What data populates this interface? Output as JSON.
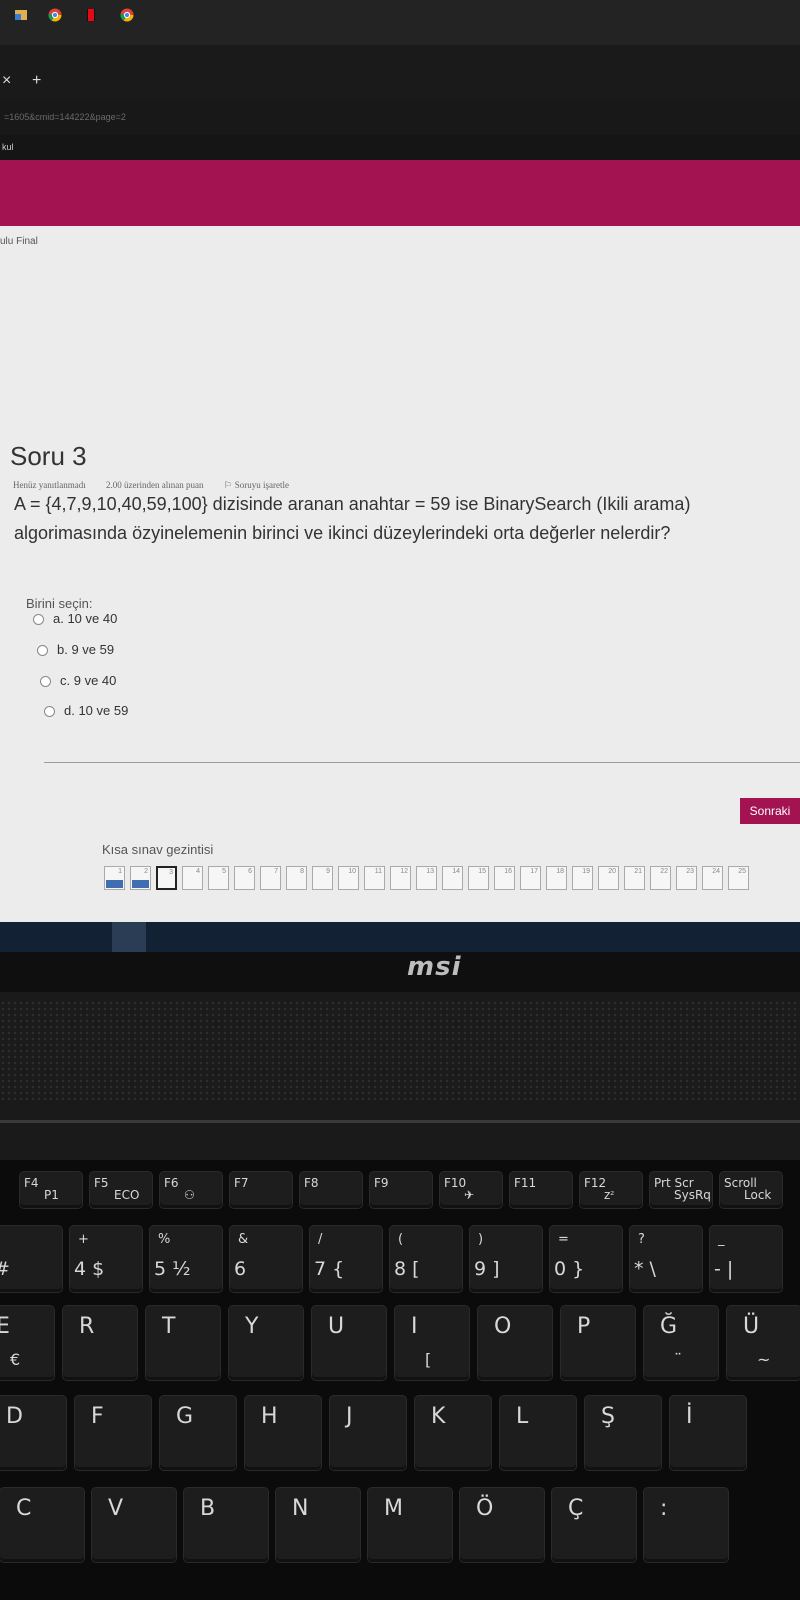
{
  "browser": {
    "tab_close": "×",
    "tab_new": "+",
    "url": "=1605&cmid=144222&page=2",
    "bookmark": "kul"
  },
  "page": {
    "breadcrumb": "ulu Final",
    "question": {
      "title": "Soru 3",
      "status": "Henüz yanıtlanmadı",
      "points": "2.00 üzerinden alınan puan",
      "flag": "Soruyu işaretle",
      "text": "A = {4,7,9,10,40,59,100} dizisinde aranan anahtar = 59 ise BinarySearch (Ikili arama) algorimasında özyinelemenin birinci ve ikinci düzeylerindeki orta değerler nelerdir?",
      "prompt": "Birini seçin:",
      "options": [
        "a. 10 ve 40",
        "b. 9 ve 59",
        "c. 9 ve 40",
        "d. 10 ve 59"
      ]
    },
    "next_button": "Sonraki",
    "nav": {
      "title": "Kısa sınav gezintisi",
      "numbers": [
        "1",
        "2",
        "3",
        "4",
        "5",
        "6",
        "7",
        "8",
        "9",
        "10",
        "11",
        "12",
        "13",
        "14",
        "15",
        "16",
        "17",
        "18",
        "19",
        "20",
        "21",
        "22",
        "23",
        "24",
        "25"
      ],
      "answered": [
        1,
        2
      ],
      "current": 3
    }
  },
  "laptop": {
    "logo": "msi",
    "fkeys": [
      {
        "label": "F4",
        "sub": "P1"
      },
      {
        "label": "F5",
        "sub": "ECO"
      },
      {
        "label": "F6",
        "sub": "⚇"
      },
      {
        "label": "F7",
        "sub": ""
      },
      {
        "label": "F8",
        "sub": ""
      },
      {
        "label": "F9",
        "sub": ""
      },
      {
        "label": "F10",
        "sub": "✈"
      },
      {
        "label": "F11",
        "sub": ""
      },
      {
        "label": "F12",
        "sub": "zᶻ"
      },
      {
        "label": "Prt Scr",
        "sub": "SysRq"
      },
      {
        "label": "Scroll",
        "sub": "Lock"
      }
    ],
    "number_keys": [
      {
        "top": "",
        "bot": "#"
      },
      {
        "top": "+",
        "bot": "4 $"
      },
      {
        "top": "%",
        "bot": "5 ½"
      },
      {
        "top": "&",
        "bot": "6"
      },
      {
        "top": "/",
        "bot": "7 {"
      },
      {
        "top": "(",
        "bot": "8 ["
      },
      {
        "top": ")",
        "bot": "9 ]"
      },
      {
        "top": "=",
        "bot": "0 }"
      },
      {
        "top": "?",
        "bot": "* \\"
      },
      {
        "top": "_",
        "bot": "- |"
      }
    ],
    "row_q": [
      {
        "main": "E",
        "alt": "€"
      },
      {
        "main": "R",
        "alt": ""
      },
      {
        "main": "T",
        "alt": ""
      },
      {
        "main": "Y",
        "alt": ""
      },
      {
        "main": "U",
        "alt": ""
      },
      {
        "main": "I",
        "alt": "[ "
      },
      {
        "main": "O",
        "alt": ""
      },
      {
        "main": "P",
        "alt": ""
      },
      {
        "main": "Ğ",
        "alt": "¨"
      },
      {
        "main": "Ü",
        "alt": "~"
      }
    ],
    "row_a": [
      "D",
      "F",
      "G",
      "H",
      "J",
      "K",
      "L",
      "Ş",
      "İ"
    ],
    "row_z": [
      "C",
      "V",
      "B",
      "N",
      "M",
      "Ö",
      "Ç",
      ":"
    ]
  }
}
